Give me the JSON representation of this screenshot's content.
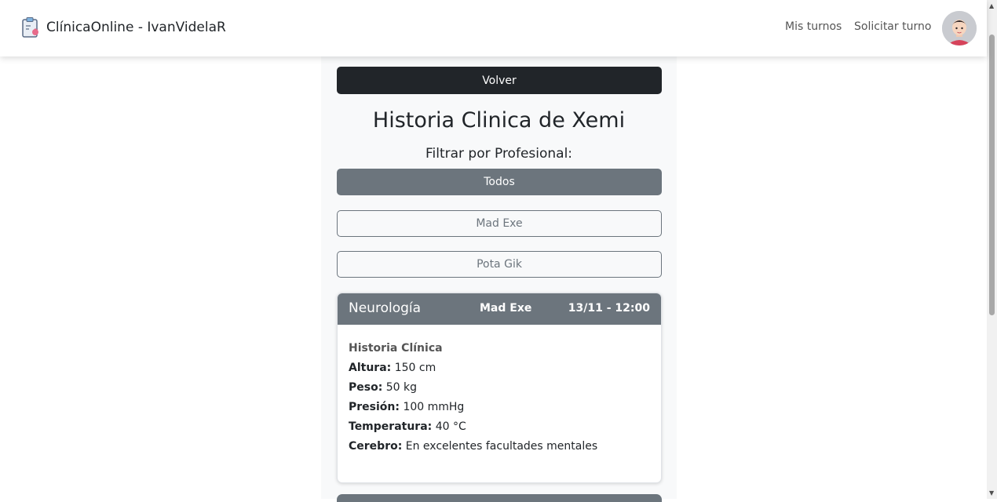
{
  "navbar": {
    "brand": "ClínicaOnline - IvanVidelaR",
    "links": [
      "Mis turnos",
      "Solicitar turno"
    ]
  },
  "page": {
    "back_label": "Volver",
    "title": "Historia Clinica de Xemi",
    "filter_label": "Filtrar por Profesional:",
    "filters": [
      "Todos",
      "Mad Exe",
      "Pota Gik"
    ]
  },
  "record": {
    "specialty": "Neurología",
    "professional": "Mad Exe",
    "datetime": "13/11 - 12:00",
    "section_title": "Historia Clínica",
    "fields": [
      {
        "label": "Altura:",
        "value": "150 cm"
      },
      {
        "label": "Peso:",
        "value": "50 kg"
      },
      {
        "label": "Presión:",
        "value": "100 mmHg"
      },
      {
        "label": "Temperatura:",
        "value": "40 °C"
      },
      {
        "label": "Cerebro:",
        "value": "En excelentes facultades mentales"
      }
    ]
  },
  "colors": {
    "primary_dark": "#212529",
    "secondary": "#6c757d",
    "panel_bg": "#f8f9fa"
  }
}
